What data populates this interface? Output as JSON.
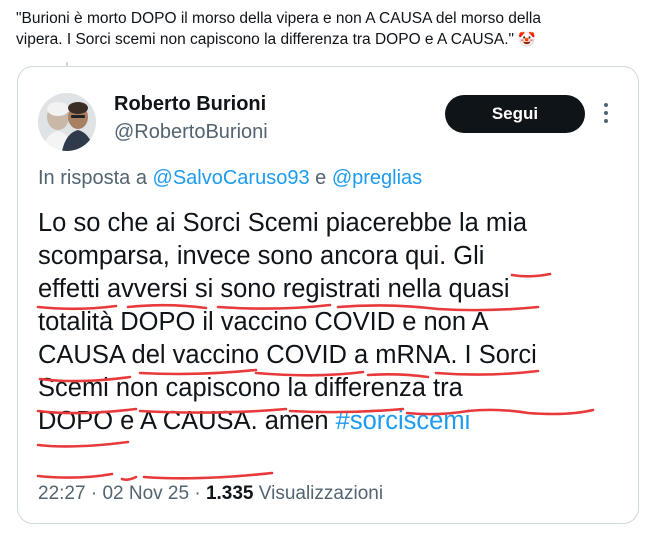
{
  "caption": {
    "line1": "\"Burioni è morto DOPO il morso della vipera e non A CAUSA del morso della",
    "line2": "vipera. I Sorci scemi non capiscono la differenza tra DOPO e A CAUSA.\"",
    "emoji": "🤡"
  },
  "tweet": {
    "author_name": "Roberto Burioni",
    "author_handle": "@RobertoBurioni",
    "follow_label": "Segui",
    "reply_prefix": "In risposta a",
    "reply_user1": "@SalvoCaruso93",
    "reply_conj": "e",
    "reply_user2": "@preglias",
    "lines": [
      "Lo so che ai Sorci Scemi piacerebbe la mia",
      "scomparsa, invece sono ancora qui. Gli",
      "effetti avversi si sono registrati nella quasi",
      "totalità DOPO il vaccino COVID e non A",
      "CAUSA del vaccino COVID a mRNA. I Sorci",
      "Scemi non capiscono la differenza tra",
      "DOPO e A CAUSA. amen"
    ],
    "hashtag": "#sorciscemi",
    "time": "22:27",
    "date": "02 Nov 25",
    "views_count": "1.335",
    "views_label": "Visualizzazioni",
    "separator": "·"
  },
  "colors": {
    "link": "#1d9bf0",
    "underline": "#e8393b",
    "button_bg": "#0f1419",
    "muted": "#536471",
    "border": "#cfd9de"
  },
  "icons": {
    "more": "more-vertical-icon",
    "emoji": "clown-face-icon"
  }
}
